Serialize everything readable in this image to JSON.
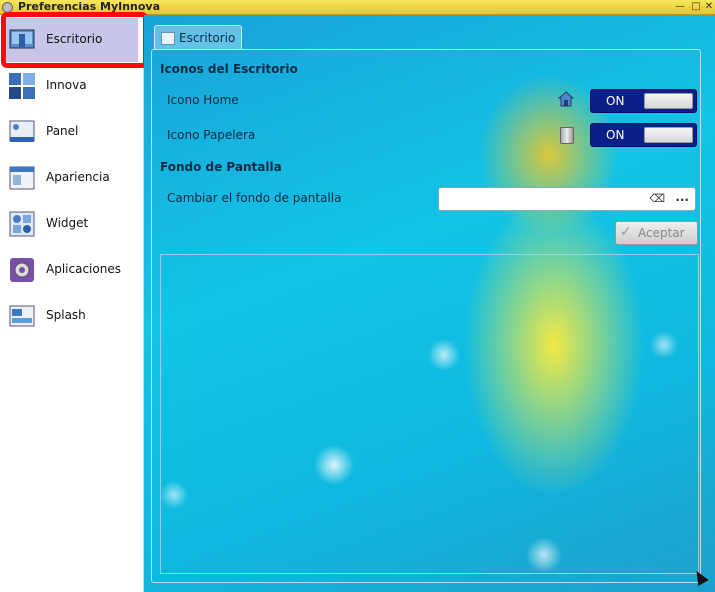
{
  "window": {
    "title": "Preferencias MyInnova"
  },
  "sidebar": {
    "items": [
      {
        "label": "Escritorio",
        "icon": "desktop-icon",
        "active": true
      },
      {
        "label": "Innova",
        "icon": "innova-icon"
      },
      {
        "label": "Panel",
        "icon": "panel-icon"
      },
      {
        "label": "Apariencia",
        "icon": "appearance-icon"
      },
      {
        "label": "Widget",
        "icon": "widget-icon"
      },
      {
        "label": "Aplicaciones",
        "icon": "applications-gear-icon"
      },
      {
        "label": "Splash",
        "icon": "splash-icon"
      }
    ]
  },
  "tab": {
    "label": "Escritorio"
  },
  "sections": {
    "icons_title": "Iconos del Escritorio",
    "home_label": "Icono Home",
    "home_toggle": "ON",
    "trash_label": "Icono Papelera",
    "trash_toggle": "ON",
    "wallpaper_title": "Fondo de Pantalla",
    "wallpaper_label": "Cambiar el fondo de pantalla",
    "wallpaper_value": "",
    "browse_label": "...",
    "accept_label": "Aceptar"
  },
  "colors": {
    "accent_highlight": "#ff0a0a",
    "active_item": "#c7c6e8",
    "toggle_bg": "#0b1f8a"
  }
}
